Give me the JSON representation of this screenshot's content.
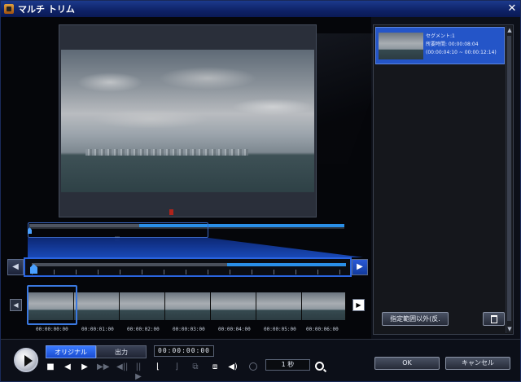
{
  "window": {
    "title": "マルチ トリム",
    "close_glyph": "✕"
  },
  "segment": {
    "title": "セグメント:1",
    "duration": "所要時間: 00:00:08:04",
    "range": "(00:00:04:10 ~ 00:00:12:14)"
  },
  "filmstrip": {
    "timecodes": [
      "00:00:00:00",
      "00:00:01:00",
      "00:00:02:00",
      "00:00:03:00",
      "00:00:04:00",
      "00:00:05:00",
      "00:00:06:00"
    ]
  },
  "buttons": {
    "delete_out_label": "指定範囲以外(反.",
    "ok_label": "OK",
    "cancel_label": "キャンセル"
  },
  "playback": {
    "tab_original": "オリジナル",
    "tab_output": "出力",
    "timecode": "00:00:00:00",
    "zoom_scale": "1 秒"
  },
  "icons": {
    "window": "app-icon",
    "play": "play-icon",
    "stop": "stop-icon",
    "prev_frame": "prev-frame-icon",
    "next_frame": "next-frame-icon",
    "fast_forward": "fast-forward-icon",
    "volume": "volume-icon"
  },
  "colors": {
    "accent": "#2a8fe8",
    "selection": "#2455c8",
    "title_bar": "#0e2266"
  }
}
